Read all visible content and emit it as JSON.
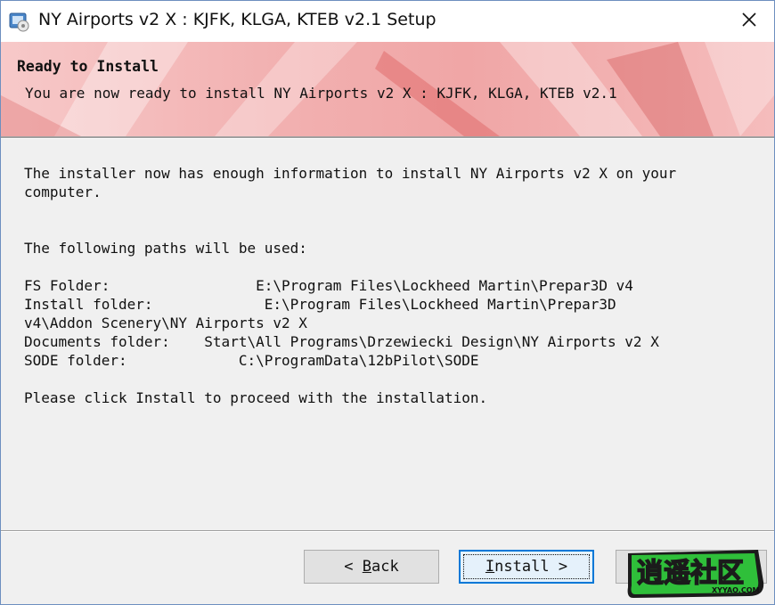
{
  "window": {
    "title": "NY Airports v2 X : KJFK, KLGA, KTEB v2.1 Setup",
    "app_icon": "installer-icon",
    "close_icon": "close-icon"
  },
  "banner": {
    "heading": "Ready to Install",
    "subheading": "You are now ready to install NY Airports v2 X : KJFK, KLGA, KTEB v2.1"
  },
  "content": {
    "intro_line1": "The installer now has enough information to install NY Airports v2 X on your",
    "intro_line2": "computer.",
    "paths_heading": "The following paths will be used:",
    "path_lines": [
      "FS Folder:                 E:\\Program Files\\Lockheed Martin\\Prepar3D v4",
      "Install folder:             E:\\Program Files\\Lockheed Martin\\Prepar3D",
      "v4\\Addon Scenery\\NY Airports v2 X",
      "Documents folder:    Start\\All Programs\\Drzewiecki Design\\NY Airports v2 X",
      "SODE folder:             C:\\ProgramData\\12bPilot\\SODE"
    ],
    "proceed_text": "Please click Install to proceed with the installation."
  },
  "buttons": {
    "back_prefix": "< ",
    "back_mnemonic": "B",
    "back_rest": "ack",
    "install_mnemonic": "I",
    "install_rest": "nstall >"
  },
  "watermark": {
    "text": "逍遥社区",
    "domain": "XYYAO.COM"
  },
  "colors": {
    "accent": "#0078d7",
    "banner": "#f0a6a6",
    "watermark_green": "#2fbf3a"
  }
}
